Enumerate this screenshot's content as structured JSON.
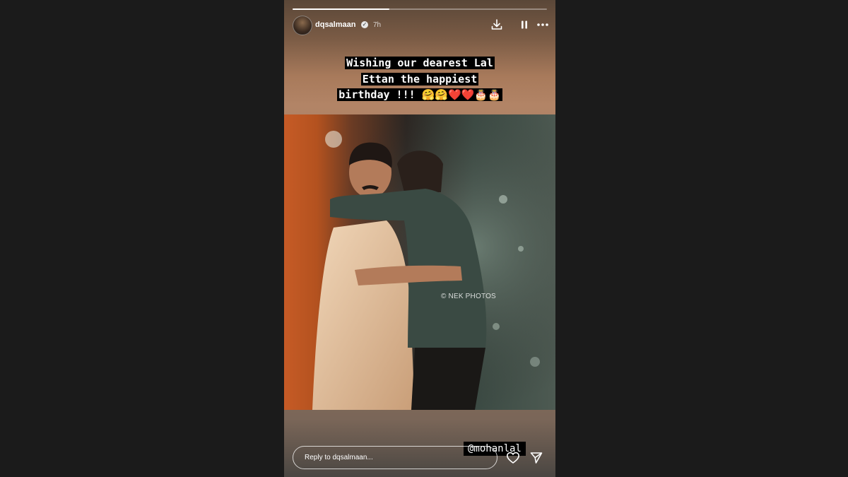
{
  "story": {
    "progress": 0.38,
    "user": {
      "username": "dqsalmaan",
      "verified": true,
      "time": "7h",
      "avatar_icon": "profile-avatar"
    },
    "header_actions": [
      {
        "name": "download",
        "icon": "download-icon"
      },
      {
        "name": "pause",
        "icon": "pause-icon"
      },
      {
        "name": "more",
        "icon": "more-icon"
      }
    ],
    "caption": {
      "line1": "Wishing our dearest Lal",
      "line2": "Ettan the happiest",
      "line3": "birthday !!! 🤗🤗❤️❤️🎂🎂"
    },
    "photo": {
      "credit": "© NEK PHOTOS"
    },
    "mention": "@mohanlal",
    "reply": {
      "placeholder": "Reply to dqsalmaan..."
    },
    "footer_actions": [
      {
        "name": "like",
        "icon": "heart-icon"
      },
      {
        "name": "share",
        "icon": "send-icon"
      }
    ],
    "colors": {
      "page_background": "#1b1b1b",
      "caption_highlight": "#000000",
      "text": "#ffffff"
    }
  }
}
